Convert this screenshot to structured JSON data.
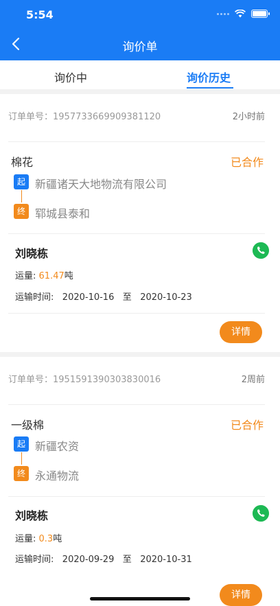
{
  "status_bar": {
    "time": "5:54"
  },
  "nav": {
    "title": "询价单"
  },
  "tabs": [
    {
      "label": "询价中"
    },
    {
      "label": "询价历史"
    }
  ],
  "orders": [
    {
      "order_label": "订单单号：1957733669909381120",
      "time_ago": "2小时前",
      "goods": "棉花",
      "status": "已合作",
      "start_badge": "起",
      "start": "新疆诸天大地物流有限公司",
      "end_badge": "终",
      "end": "郓城县泰和",
      "driver": "刘晓栋",
      "volume_label": "运量: ",
      "volume": "61.47",
      "volume_unit": "吨",
      "transport_label": "运输时间:",
      "date_from": "2020-10-16",
      "date_sep": "至",
      "date_to": "2020-10-23",
      "detail_label": "详情"
    },
    {
      "order_label": "订单单号：1951591390303830016",
      "time_ago": "2周前",
      "goods": "一级棉",
      "status": "已合作",
      "start_badge": "起",
      "start": "新疆农资",
      "end_badge": "终",
      "end": "永通物流",
      "driver": "刘晓栋",
      "volume_label": "运量: ",
      "volume": "0.3",
      "volume_unit": "吨",
      "transport_label": "运输时间:",
      "date_from": "2020-09-29",
      "date_sep": "至",
      "date_to": "2020-10-31",
      "detail_label": "详情"
    }
  ],
  "colors": {
    "primary": "#1a7cf5",
    "accent": "#f28a1c",
    "phone": "#1db954"
  }
}
